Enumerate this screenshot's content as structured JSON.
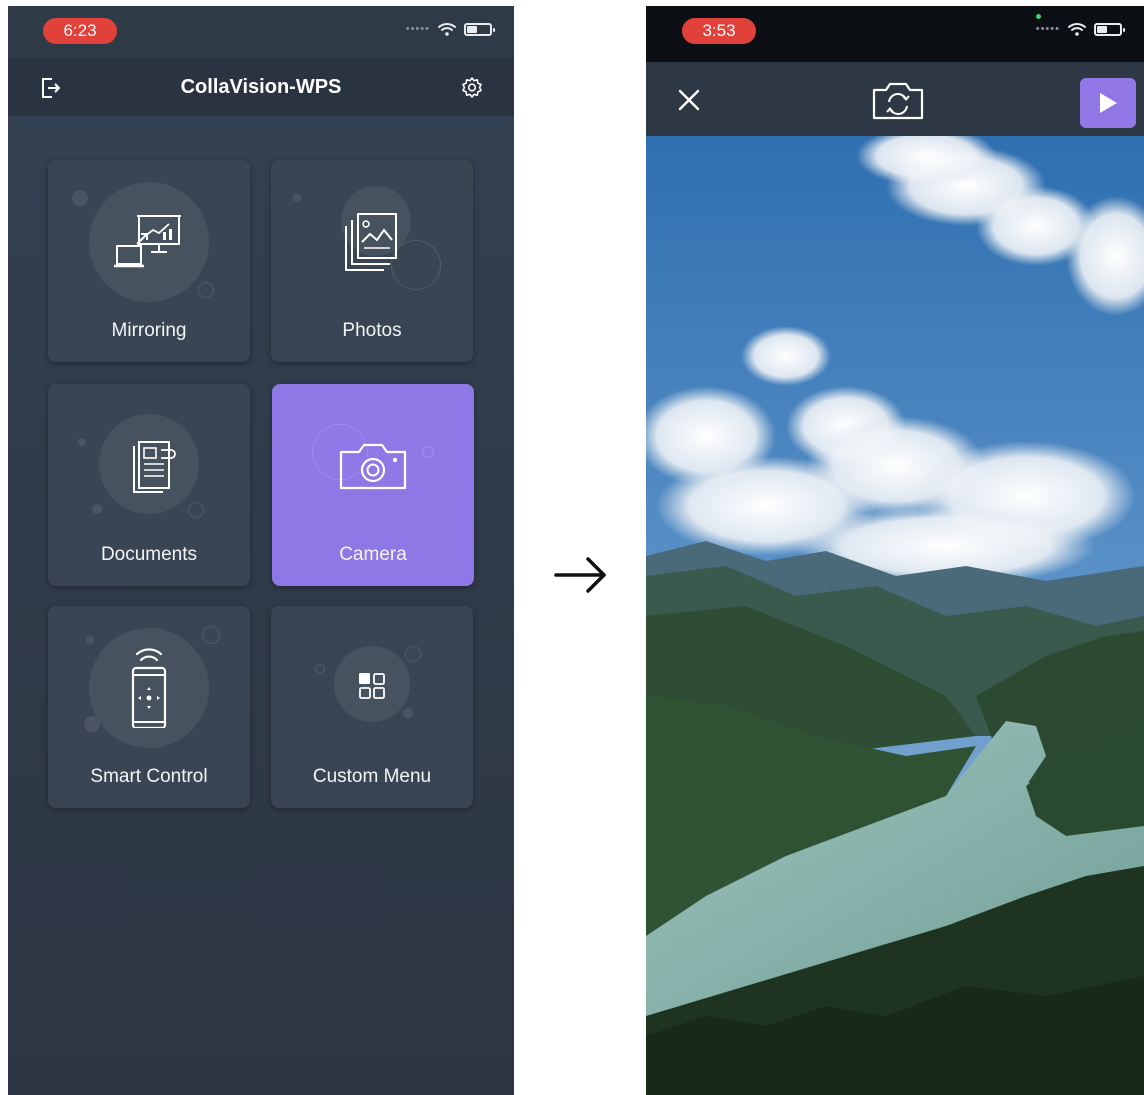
{
  "left_phone": {
    "status": {
      "time": "6:23"
    },
    "header": {
      "title": "CollaVision-WPS",
      "logout_icon": "logout-icon",
      "settings_icon": "gear-icon"
    },
    "tiles": [
      {
        "label": "Mirroring",
        "icon": "mirroring-icon",
        "active": false
      },
      {
        "label": "Photos",
        "icon": "photos-icon",
        "active": false
      },
      {
        "label": "Documents",
        "icon": "documents-icon",
        "active": false
      },
      {
        "label": "Camera",
        "icon": "camera-icon",
        "active": true
      },
      {
        "label": "Smart Control",
        "icon": "smart-control-icon",
        "active": false
      },
      {
        "label": "Custom Menu",
        "icon": "custom-menu-icon",
        "active": false
      }
    ]
  },
  "flow_arrow": "right-arrow-icon",
  "right_phone": {
    "status": {
      "time": "3:53"
    },
    "toolbar": {
      "close_icon": "close-icon",
      "switch_camera_icon": "switch-camera-icon",
      "play_icon": "play-icon"
    },
    "camera_view": "live camera preview"
  },
  "colors": {
    "background": "#2f3a47",
    "header": "#2a3340",
    "tile": "#3a4553",
    "accent": "#8e78e6",
    "time_pill": "#e0413a"
  }
}
